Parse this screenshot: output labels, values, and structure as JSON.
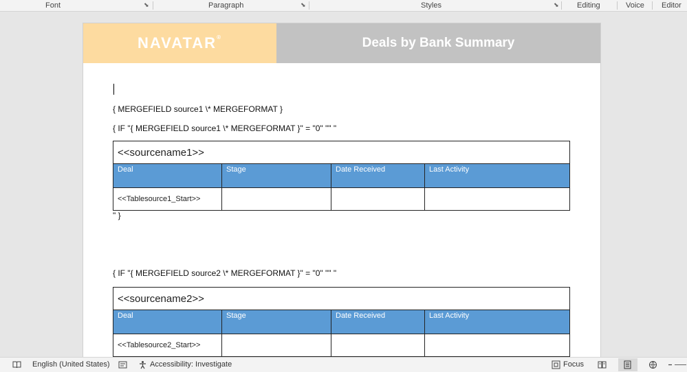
{
  "ribbon": {
    "groups": [
      {
        "label": "Font"
      },
      {
        "label": "Paragraph"
      },
      {
        "label": "Styles"
      },
      {
        "label": "Editing"
      },
      {
        "label": "Voice"
      },
      {
        "label": "Editor"
      }
    ],
    "launcher_glyph": "⬊"
  },
  "document": {
    "header": {
      "logo": "NAVATAR",
      "logo_mark": "®",
      "title": "Deals by Bank Summary"
    },
    "lines": {
      "mergefield_source1": "{ MERGEFIELD  source1  \\* MERGEFORMAT }",
      "if_source1": "{ IF  \"{ MERGEFIELD  source1  \\* MERGEFORMAT }\" = \"0\" \"\" \"",
      "close_source1": "\" }",
      "if_source2": "{ IF  \"{ MERGEFIELD  source2  \\* MERGEFORMAT }\" = \"0\" \"\" \""
    },
    "tables": [
      {
        "name": "<<sourcename1>>",
        "columns": [
          "Deal",
          "Stage",
          "Date Received",
          "Last Activity"
        ],
        "rows": [
          [
            "<<Tablesource1_Start>>",
            "",
            "",
            ""
          ]
        ]
      },
      {
        "name": "<<sourcename2>>",
        "columns": [
          "Deal",
          "Stage",
          "Date Received",
          "Last Activity"
        ],
        "rows": [
          [
            "<<Tablesource2_Start>>",
            "",
            "",
            ""
          ]
        ]
      }
    ]
  },
  "statusbar": {
    "language": "English (United States)",
    "accessibility": "Accessibility: Investigate",
    "focus": "Focus"
  },
  "colors": {
    "header_logo_bg": "#fddba0",
    "header_title_bg": "#c2c2c2",
    "table_header_bg": "#5b9bd5"
  }
}
